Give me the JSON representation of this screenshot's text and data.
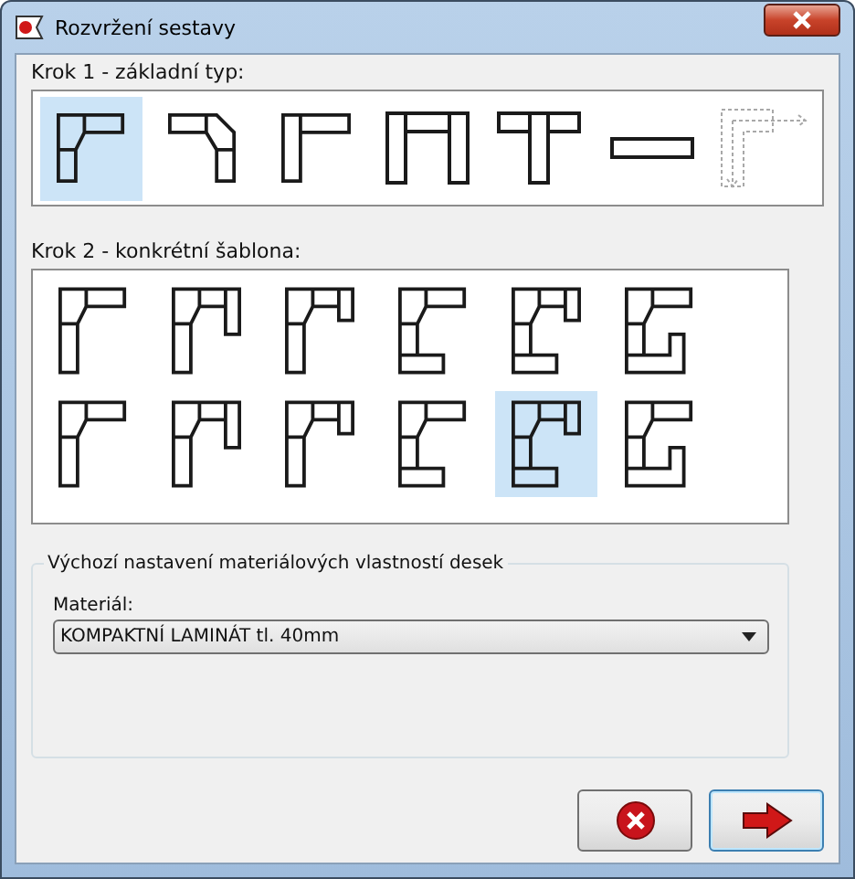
{
  "window": {
    "title": "Rozvržení sestavy"
  },
  "step1": {
    "label": "Krok 1 - základní typ:",
    "types": [
      {
        "kind": "corner-diagonal",
        "selected": true
      },
      {
        "kind": "t-diagonal",
        "selected": false
      },
      {
        "kind": "corner",
        "selected": false
      },
      {
        "kind": "u",
        "selected": false
      },
      {
        "kind": "t",
        "selected": false
      },
      {
        "kind": "straight",
        "selected": false
      },
      {
        "kind": "axes",
        "selected": false
      }
    ]
  },
  "step2": {
    "label": "Krok 2 - konkrétní šablona:",
    "templates": [
      {
        "kind": "l",
        "selected": false
      },
      {
        "kind": "u-long",
        "selected": false
      },
      {
        "kind": "u-short",
        "selected": false
      },
      {
        "kind": "c",
        "selected": false
      },
      {
        "kind": "c-leg",
        "selected": false
      },
      {
        "kind": "g",
        "selected": false
      },
      {
        "kind": "l",
        "selected": false
      },
      {
        "kind": "u-long",
        "selected": false
      },
      {
        "kind": "u-short",
        "selected": false
      },
      {
        "kind": "c",
        "selected": false
      },
      {
        "kind": "c-leg",
        "selected": true
      },
      {
        "kind": "g",
        "selected": false
      }
    ]
  },
  "defaults": {
    "legend": "Výchozí nastavení materiálových vlastností desek",
    "material_label": "Materiál:",
    "material_value": "KOMPAKTNÍ LAMINÁT tl. 40mm"
  },
  "buttons": [
    {
      "kind": "cancel"
    },
    {
      "kind": "next"
    }
  ]
}
